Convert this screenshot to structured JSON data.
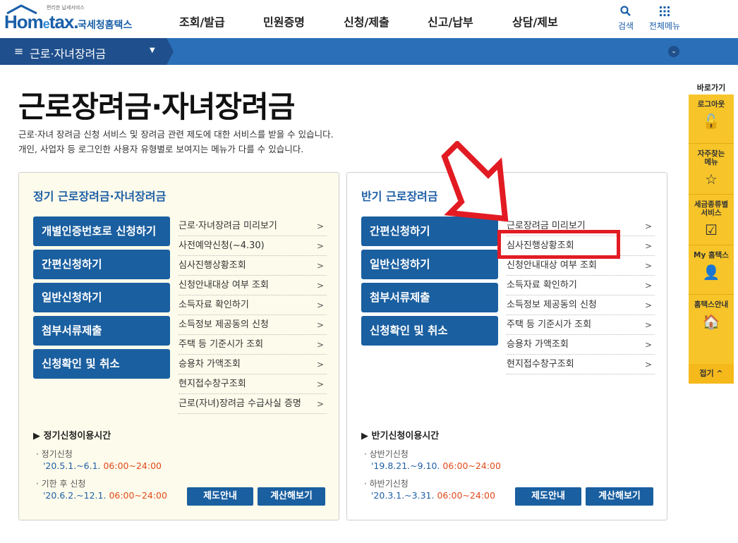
{
  "header": {
    "logo_small": "편리한 납세서비스",
    "logo_main_a": "Hom",
    "logo_main_e": "e",
    "logo_main_b": "tax.",
    "logo_kr": "국세청홈택스",
    "nav": [
      "조회/발급",
      "민원증명",
      "신청/제출",
      "신고/납부",
      "상담/제보"
    ],
    "search_label": "검색",
    "allmenu_label": "전체메뉴"
  },
  "breadcrumb": {
    "title": "근로·자녀장려금"
  },
  "page": {
    "title": "근로장려금·자녀장려금",
    "desc1": "근로·자녀 장려금 신청 서비스 및 장려금 관련 제도에 대한 서비스를 받을 수 있습니다.",
    "desc2": "개인, 사업자 등 로그인한 사용자 유형별로 보여지는 메뉴가 다를 수 있습니다."
  },
  "left": {
    "title": "정기 근로장려금·자녀장려금",
    "buttons": [
      "개별인증번호로 신청하기",
      "간편신청하기",
      "일반신청하기",
      "첨부서류제출",
      "신청확인 및 취소"
    ],
    "links": [
      "근로·자녀장려금 미리보기",
      "사전예약신청(~4.30)",
      "심사진행상황조회",
      "신청안내대상 여부 조회",
      "소득자료 확인하기",
      "소득정보 제공동의 신청",
      "주택 등 기준시가 조회",
      "승용차 가액조회",
      "현지접수창구조회",
      "근로(자녀)장려금 수급사실 증명"
    ],
    "period_title": "정기신청이용시간",
    "p1_label": "정기신청",
    "p1_date": "'20.5.1.~6.1.",
    "p1_time": "06:00~24:00",
    "p2_label": "기한 후 신청",
    "p2_date": "'20.6.2.~12.1.",
    "p2_time": "06:00~24:00",
    "btn_guide": "제도안내",
    "btn_calc": "계산해보기"
  },
  "right": {
    "title": "반기 근로장려금",
    "buttons": [
      "간편신청하기",
      "일반신청하기",
      "첨부서류제출",
      "신청확인 및 취소"
    ],
    "links": [
      "근로장려금 미리보기",
      "심사진행상황조회",
      "신청안내대상 여부 조회",
      "소득자료 확인하기",
      "소득정보 제공동의 신청",
      "주택 등 기준시가 조회",
      "승용차 가액조회",
      "현지접수창구조회"
    ],
    "period_title": "반기신청이용시간",
    "p1_label": "상반기신청",
    "p1_date": "'19.8.21.~9.10.",
    "p1_time": "06:00~24:00",
    "p2_label": "하반기신청",
    "p2_date": "'20.3.1.~3.31.",
    "p2_time": "06:00~24:00",
    "btn_guide": "제도안내",
    "btn_calc": "계산해보기"
  },
  "side": {
    "head": "바로가기",
    "items": [
      "로그아웃",
      "자주찾는 메뉴",
      "세금종류별 서비스",
      "My 홈택스",
      "홈택스안내"
    ],
    "fold": "접기 ^"
  },
  "colors": {
    "primary": "#1a5fa0",
    "accent": "#e21b23",
    "side": "#f7c52a",
    "time": "#e04a1a"
  }
}
